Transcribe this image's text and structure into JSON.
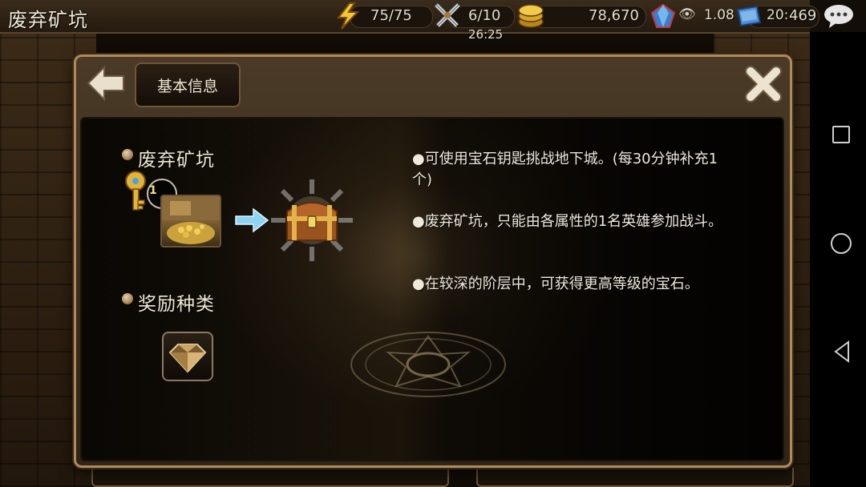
{
  "topbar": {
    "title": "废弃矿坑",
    "stamina": "75/75",
    "battles": "6/10",
    "timer": "26:25",
    "gold": "78,670",
    "gems": "469",
    "status_clock": "20:",
    "status_speed": "1.08"
  },
  "dialog": {
    "tab_label": "基本信息",
    "dungeon_name": "废弃矿坑",
    "key_count": "1",
    "reward_title": "奖励种类",
    "descriptions": [
      "●可使用宝石钥匙挑战地下城。(每30分钟补充1个)",
      "●废弃矿坑，只能由各属性的1名英雄参加战斗。",
      "●在较深的阶层中，可获得更高等级的宝石。"
    ]
  },
  "icons": {
    "stamina": "lightning-icon",
    "battles": "crossed-swords-icon",
    "gold": "coin-stack-icon",
    "gems": "crystal-icon",
    "chat": "chat-bubble-icon",
    "back": "back-arrow-icon",
    "close": "close-x-icon",
    "key": "key-icon",
    "chest": "treasure-chest-icon",
    "reward": "diamond-icon"
  },
  "colors": {
    "frame_border": "#b08a5a",
    "text_primary": "#efe9dc",
    "key_count": "#f4e36a"
  }
}
